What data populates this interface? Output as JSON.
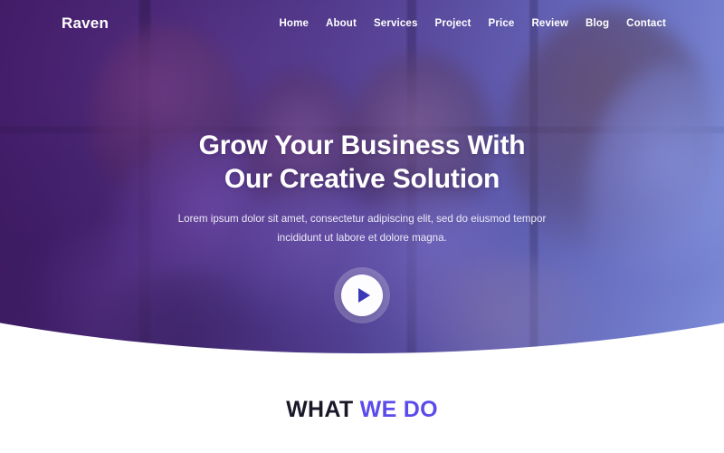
{
  "brand": {
    "logo": "Raven",
    "accent_color": "#5b4bea",
    "hero_gradient_from": "#561e82",
    "hero_gradient_to": "#768ae2",
    "play_icon_color": "#3b38b8"
  },
  "header": {
    "nav": [
      {
        "label": "Home",
        "name": "nav-home"
      },
      {
        "label": "About",
        "name": "nav-about"
      },
      {
        "label": "Services",
        "name": "nav-services"
      },
      {
        "label": "Project",
        "name": "nav-project"
      },
      {
        "label": "Price",
        "name": "nav-price"
      },
      {
        "label": "Review",
        "name": "nav-review"
      },
      {
        "label": "Blog",
        "name": "nav-blog"
      },
      {
        "label": "Contact",
        "name": "nav-contact"
      }
    ]
  },
  "hero": {
    "title_line1": "Grow Your Business With",
    "title_line2": "Our Creative Solution",
    "subtitle_line1": "Lorem ipsum dolor sit amet, consectetur adipiscing elit, sed do",
    "subtitle_line2": "eiusmod tempor incididunt ut labore et dolore magna.",
    "play_icon": "play-icon",
    "background_image_description": "Team of coworkers collaborating around a laptop in an office"
  },
  "what_we_do": {
    "title_part1": "WHAT ",
    "title_part2": "WE DO"
  }
}
